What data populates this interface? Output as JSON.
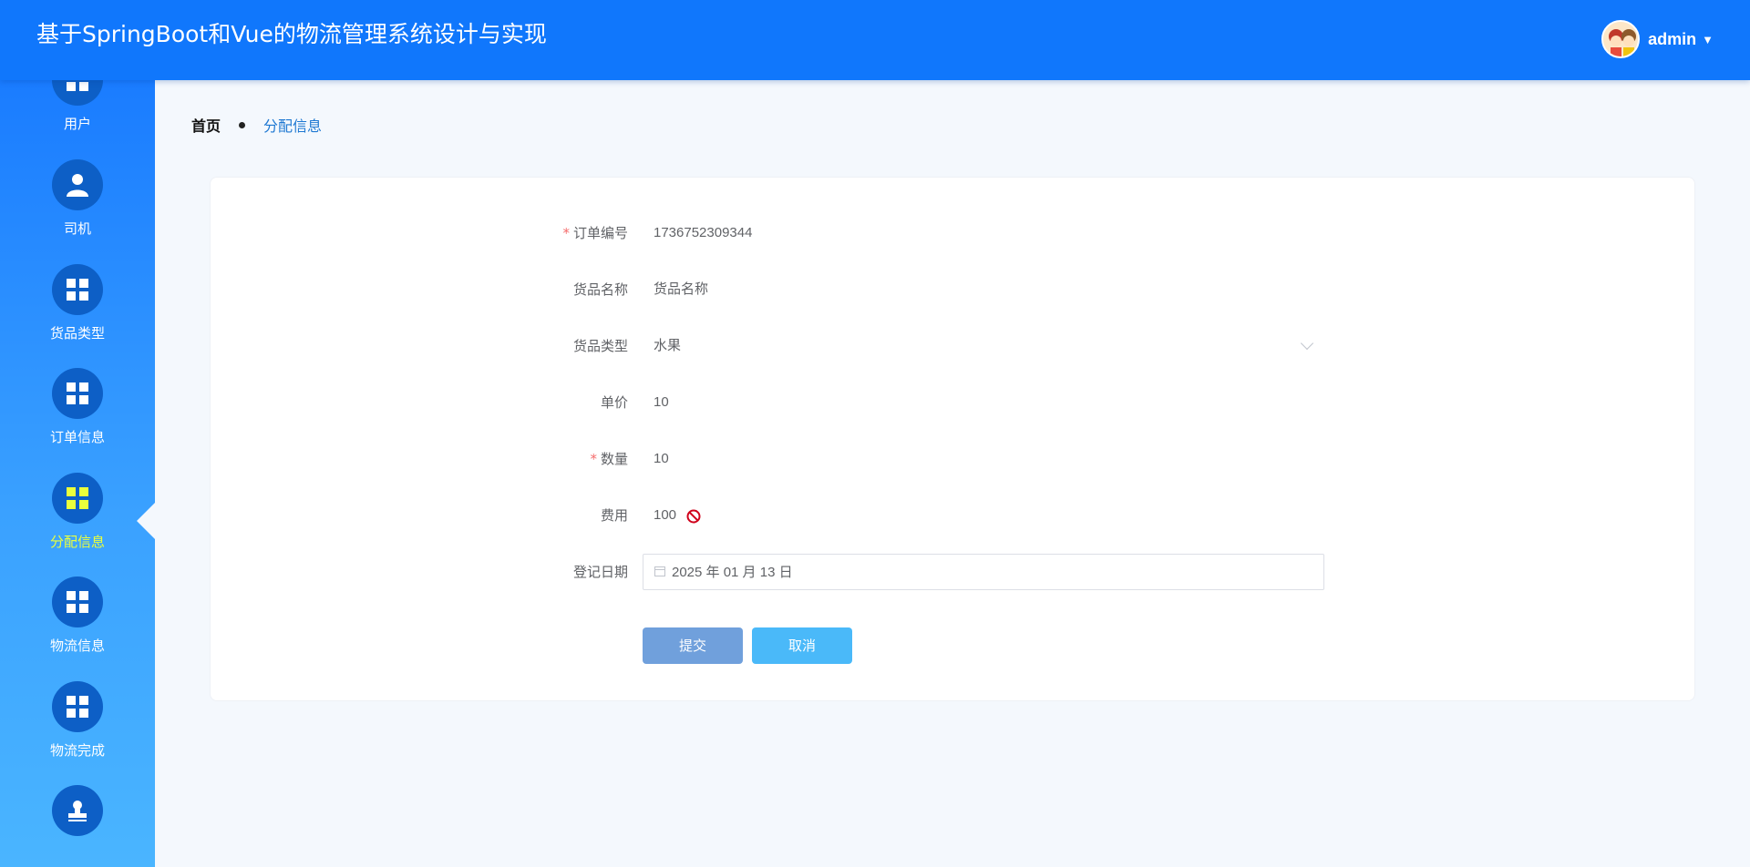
{
  "header": {
    "title": "基于SpringBoot和Vue的物流管理系统设计与实现",
    "username": "admin"
  },
  "sidebar": {
    "items": [
      {
        "label": "用户"
      },
      {
        "label": "司机"
      },
      {
        "label": "货品类型"
      },
      {
        "label": "订单信息"
      },
      {
        "label": "分配信息",
        "active": true
      },
      {
        "label": "物流信息"
      },
      {
        "label": "物流完成"
      },
      {
        "label": ""
      }
    ]
  },
  "breadcrumb": {
    "home": "首页",
    "current": "分配信息"
  },
  "form": {
    "order_no": {
      "label": "订单编号",
      "value": "1736752309344",
      "required": true
    },
    "goods_name": {
      "label": "货品名称",
      "value": "货品名称"
    },
    "goods_type": {
      "label": "货品类型",
      "value": "水果"
    },
    "unit_price": {
      "label": "单价",
      "value": "10"
    },
    "quantity": {
      "label": "数量",
      "value": "10",
      "required": true
    },
    "fee": {
      "label": "费用",
      "value": "100"
    },
    "reg_date": {
      "label": "登记日期",
      "value": "2025 年 01 月 13 日"
    },
    "submit_label": "提交",
    "cancel_label": "取消"
  },
  "colors": {
    "header": "#1077fc",
    "active_nav": "#eaff3c",
    "required": "#f56c6c",
    "submit": "#70a0dc",
    "cancel": "#4ab9f9"
  },
  "icons": [
    "user-icon",
    "driver-icon",
    "grid-icon",
    "no-entry-icon",
    "calendar-icon",
    "seal-icon"
  ]
}
